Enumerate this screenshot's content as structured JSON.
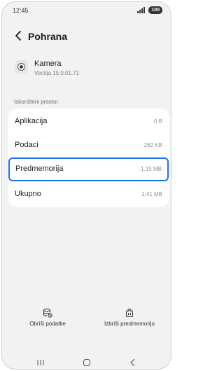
{
  "status_bar": {
    "time": "12:45",
    "battery": "100"
  },
  "header": {
    "title": "Pohrana"
  },
  "app": {
    "name": "Kamera",
    "version": "Verzija 15.0.01.71"
  },
  "section": {
    "label": "Iskorišteni prostor"
  },
  "storage_rows": [
    {
      "label": "Aplikacija",
      "value": "0 B"
    },
    {
      "label": "Podaci",
      "value": "262 KB"
    },
    {
      "label": "Predmemorija",
      "value": "1,15 MB"
    },
    {
      "label": "Ukupno",
      "value": "1,41 MB"
    }
  ],
  "actions": {
    "clear_data": "Obriši podatke",
    "clear_cache": "Izbriši predmemoriju"
  },
  "colors": {
    "highlight": "#1a73e8",
    "background": "#f2f2f2"
  },
  "icons": {
    "back": "arrow-left-icon",
    "app": "camera-icon",
    "clear_data": "database-clear-icon",
    "clear_cache": "cache-clear-icon",
    "nav_recents": "recents-icon",
    "nav_home": "home-icon",
    "nav_back": "back-icon"
  }
}
